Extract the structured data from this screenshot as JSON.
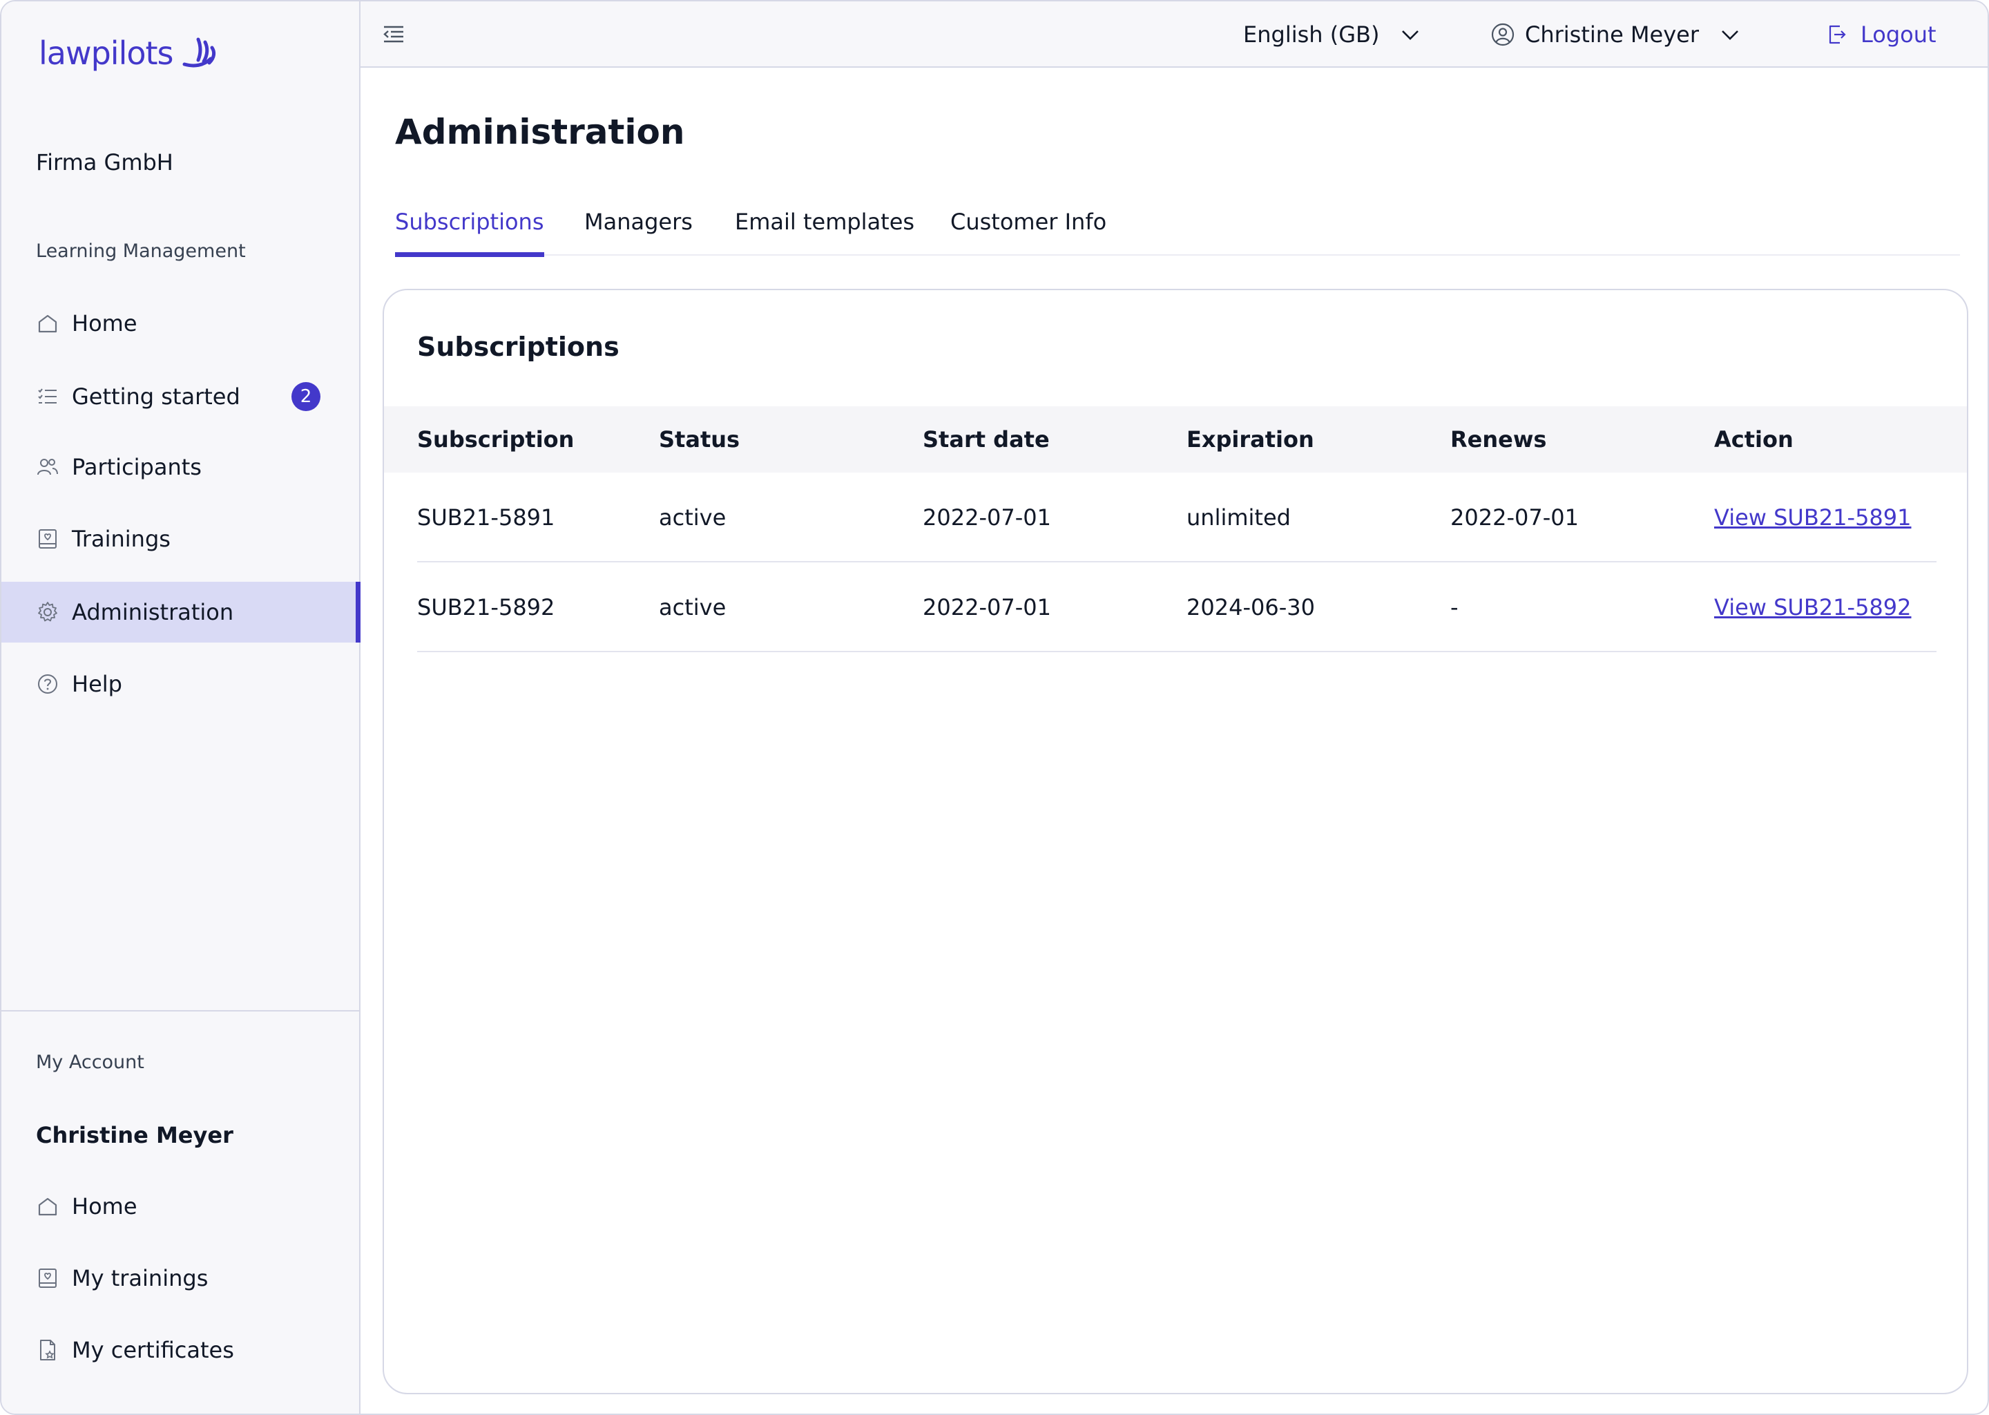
{
  "brand": {
    "logo_text": "lawpilots",
    "accent": "#4338ca"
  },
  "sidebar": {
    "org_name": "Firma GmbH",
    "section_learning": "Learning Management",
    "items": [
      {
        "label": "Home",
        "icon": "home-icon"
      },
      {
        "label": "Getting started",
        "icon": "checklist-icon",
        "badge": "2"
      },
      {
        "label": "Participants",
        "icon": "users-icon"
      },
      {
        "label": "Trainings",
        "icon": "training-icon"
      },
      {
        "label": "Administration",
        "icon": "gear-icon",
        "active": true
      },
      {
        "label": "Help",
        "icon": "help-icon"
      }
    ],
    "section_account": "My Account",
    "account_name": "Christine Meyer",
    "account_items": [
      {
        "label": "Home",
        "icon": "home-icon"
      },
      {
        "label": "My trainings",
        "icon": "training-icon"
      },
      {
        "label": "My certificates",
        "icon": "certificate-icon"
      }
    ]
  },
  "topbar": {
    "language": "English (GB)",
    "user": "Christine Meyer",
    "logout": "Logout"
  },
  "main": {
    "title": "Administration",
    "tabs": [
      {
        "label": "Subscriptions",
        "active": true
      },
      {
        "label": "Managers"
      },
      {
        "label": "Email templates"
      },
      {
        "label": "Customer Info"
      }
    ],
    "card": {
      "title": "Subscriptions",
      "columns": [
        "Subscription",
        "Status",
        "Start date",
        "Expiration",
        "Renews",
        "Action"
      ],
      "rows": [
        {
          "subscription": "SUB21-5891",
          "status": "active",
          "start": "2022-07-01",
          "expiration": "unlimited",
          "renews": "2022-07-01",
          "action": "View SUB21-5891"
        },
        {
          "subscription": "SUB21-5892",
          "status": "active",
          "start": "2022-07-01",
          "expiration": "2024-06-30",
          "renews": "-",
          "action": "View SUB21-5892"
        }
      ]
    }
  }
}
